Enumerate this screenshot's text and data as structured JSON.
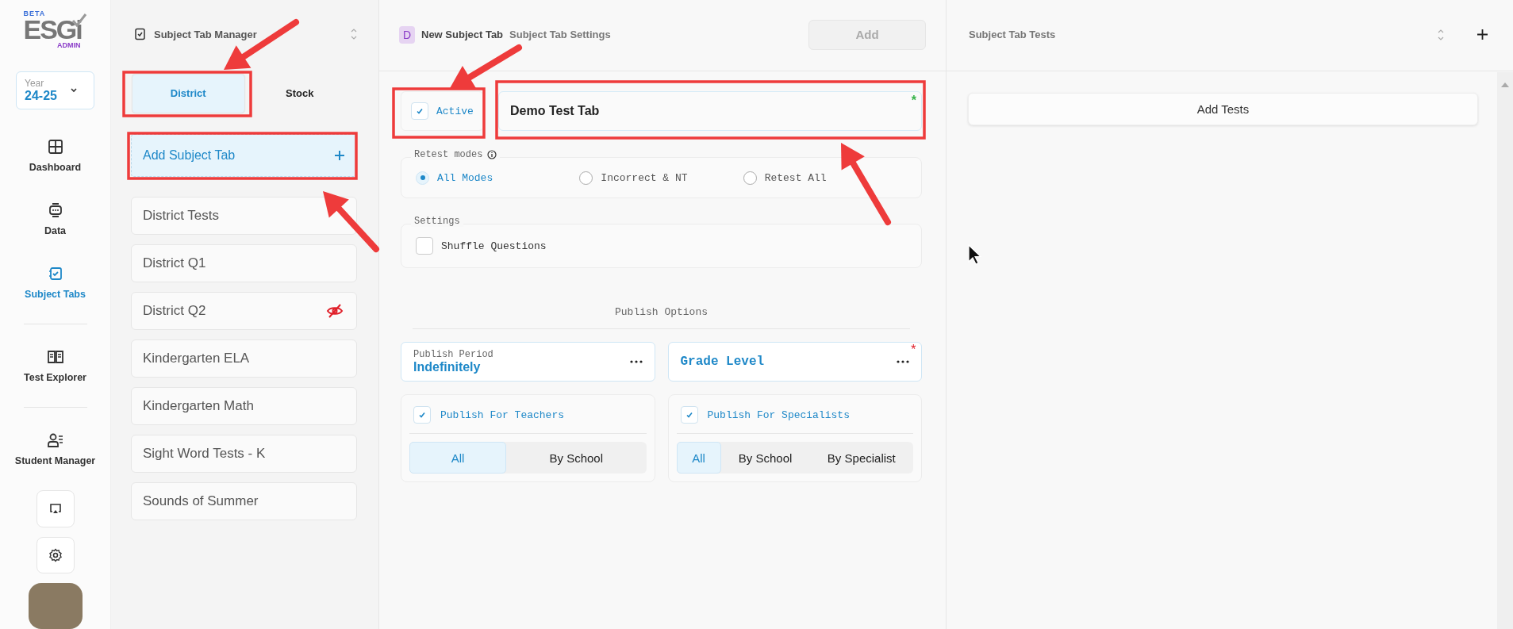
{
  "logo": {
    "badge": "BETA",
    "name": "ESGi",
    "role": "ADMIN"
  },
  "year_select": {
    "label": "Year",
    "value": "24-25"
  },
  "nav": [
    {
      "label": "Dashboard",
      "selected": false
    },
    {
      "label": "Data",
      "selected": false
    },
    {
      "label": "Subject Tabs",
      "selected": true
    },
    {
      "label": "Test Explorer",
      "selected": false
    },
    {
      "label": "Student Manager",
      "selected": false
    }
  ],
  "manager": {
    "title": "Subject Tab Manager",
    "tabs": [
      {
        "label": "District",
        "selected": true
      },
      {
        "label": "Stock",
        "selected": false
      }
    ],
    "add_button": "Add Subject Tab",
    "items": [
      {
        "label": "District Tests",
        "hidden": false
      },
      {
        "label": "District Q1",
        "hidden": false
      },
      {
        "label": "District Q2",
        "hidden": true
      },
      {
        "label": "Kindergarten ELA",
        "hidden": false
      },
      {
        "label": "Kindergarten Math",
        "hidden": false
      },
      {
        "label": "Sight Word Tests - K",
        "hidden": false
      },
      {
        "label": "Sounds of Summer",
        "hidden": false
      }
    ]
  },
  "settings": {
    "badge": "D",
    "title": "New Subject Tab",
    "subtitle": "Subject Tab Settings",
    "add_button": {
      "label": "Add",
      "disabled": true
    },
    "active": {
      "label": "Active",
      "checked": true
    },
    "name_field": {
      "value": "Demo Test Tab",
      "required_mark": "*"
    },
    "retest": {
      "legend": "Retest modes",
      "options": [
        {
          "label": "All Modes",
          "selected": true
        },
        {
          "label": "Incorrect & NT",
          "selected": false
        },
        {
          "label": "Retest All",
          "selected": false
        }
      ]
    },
    "settings_group": {
      "legend": "Settings",
      "shuffle": {
        "label": "Shuffle Questions",
        "checked": false
      }
    },
    "publish_heading": "Publish Options",
    "publish_period": {
      "label": "Publish Period",
      "value": "Indefinitely"
    },
    "grade_level": {
      "label": "Grade Level",
      "required_mark": "*"
    },
    "audiences": [
      {
        "label": "Publish For Teachers",
        "checked": true,
        "segments": [
          {
            "label": "All",
            "selected": true
          },
          {
            "label": "By School",
            "selected": false
          }
        ]
      },
      {
        "label": "Publish For Specialists",
        "checked": true,
        "segments": [
          {
            "label": "All",
            "selected": true
          },
          {
            "label": "By School",
            "selected": false
          },
          {
            "label": "By Specialist",
            "selected": false
          }
        ]
      }
    ]
  },
  "tests": {
    "title": "Subject Tab Tests",
    "add_tests": "Add Tests"
  }
}
